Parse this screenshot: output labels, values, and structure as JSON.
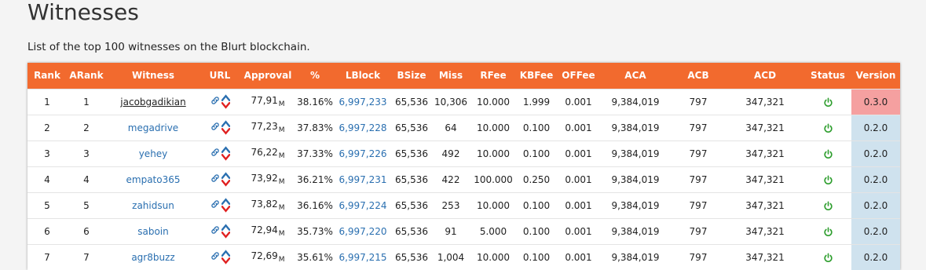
{
  "page": {
    "title": "Witnesses",
    "subtitle": "List of the top 100 witnesses on the Blurt blockchain."
  },
  "colors": {
    "header_bg": "#f26a2e",
    "link": "#2a6fb0",
    "status_on": "#2e9e2e",
    "version_current": "#cfe2ee",
    "version_outdated": "#f5a0a0",
    "vote_up": "#2a6fb0",
    "vote_down": "#e02020"
  },
  "table": {
    "columns": [
      "Rank",
      "ARank",
      "Witness",
      "URL",
      "Approval",
      "%",
      "LBlock",
      "BSize",
      "Miss",
      "RFee",
      "KBFee",
      "OFFee",
      "ACA",
      "ACB",
      "ACD",
      "Status",
      "Version"
    ],
    "approval_unit": "M",
    "url_icon": "link-icon",
    "status_icon": "power-icon",
    "rows": [
      {
        "rank": "1",
        "arank": "1",
        "witness": "jacobgadikian",
        "approval": "77,91",
        "pct": "38.16%",
        "lblock": "6,997,233",
        "bsize": "65,536",
        "miss": "10,306",
        "rfee": "10.000",
        "kbfee": "1.999",
        "offee": "0.001",
        "aca": "9,384,019",
        "acb": "797",
        "acd": "347,321",
        "version": "0.3.0"
      },
      {
        "rank": "2",
        "arank": "2",
        "witness": "megadrive",
        "approval": "77,23",
        "pct": "37.83%",
        "lblock": "6,997,228",
        "bsize": "65,536",
        "miss": "64",
        "rfee": "10.000",
        "kbfee": "0.100",
        "offee": "0.001",
        "aca": "9,384,019",
        "acb": "797",
        "acd": "347,321",
        "version": "0.2.0"
      },
      {
        "rank": "3",
        "arank": "3",
        "witness": "yehey",
        "approval": "76,22",
        "pct": "37.33%",
        "lblock": "6,997,226",
        "bsize": "65,536",
        "miss": "492",
        "rfee": "10.000",
        "kbfee": "0.100",
        "offee": "0.001",
        "aca": "9,384,019",
        "acb": "797",
        "acd": "347,321",
        "version": "0.2.0"
      },
      {
        "rank": "4",
        "arank": "4",
        "witness": "empato365",
        "approval": "73,92",
        "pct": "36.21%",
        "lblock": "6,997,231",
        "bsize": "65,536",
        "miss": "422",
        "rfee": "100.000",
        "kbfee": "0.250",
        "offee": "0.001",
        "aca": "9,384,019",
        "acb": "797",
        "acd": "347,321",
        "version": "0.2.0"
      },
      {
        "rank": "5",
        "arank": "5",
        "witness": "zahidsun",
        "approval": "73,82",
        "pct": "36.16%",
        "lblock": "6,997,224",
        "bsize": "65,536",
        "miss": "253",
        "rfee": "10.000",
        "kbfee": "0.100",
        "offee": "0.001",
        "aca": "9,384,019",
        "acb": "797",
        "acd": "347,321",
        "version": "0.2.0"
      },
      {
        "rank": "6",
        "arank": "6",
        "witness": "saboin",
        "approval": "72,94",
        "pct": "35.73%",
        "lblock": "6,997,220",
        "bsize": "65,536",
        "miss": "91",
        "rfee": "5.000",
        "kbfee": "0.100",
        "offee": "0.001",
        "aca": "9,384,019",
        "acb": "797",
        "acd": "347,321",
        "version": "0.2.0"
      },
      {
        "rank": "7",
        "arank": "7",
        "witness": "agr8buzz",
        "approval": "72,69",
        "pct": "35.61%",
        "lblock": "6,997,215",
        "bsize": "65,536",
        "miss": "1,004",
        "rfee": "10.000",
        "kbfee": "0.100",
        "offee": "0.001",
        "aca": "9,384,019",
        "acb": "797",
        "acd": "347,321",
        "version": "0.2.0"
      }
    ]
  }
}
